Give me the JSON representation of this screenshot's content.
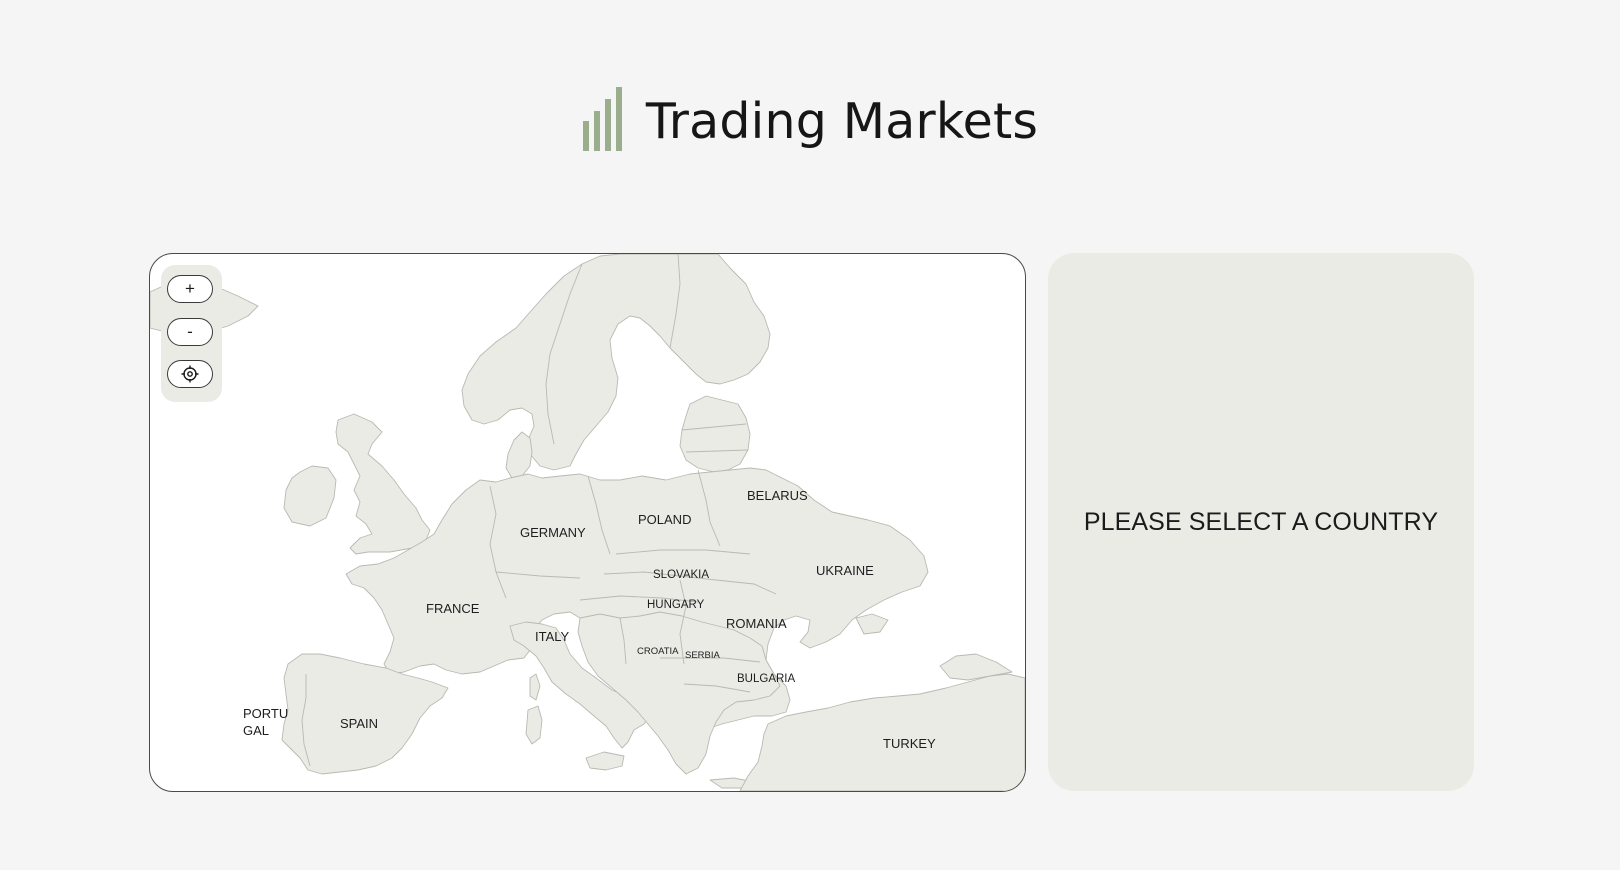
{
  "header": {
    "title": "Trading Markets",
    "logo_icon": "bar-chart-icon",
    "logo_color": "#9aae8d"
  },
  "map": {
    "controls": {
      "zoom_in_label": "+",
      "zoom_out_label": "-",
      "recenter_icon": "crosshair-icon"
    },
    "countries": {
      "germany": "GERMANY",
      "poland": "POLAND",
      "belarus": "BELARUS",
      "ukraine": "UKRAINE",
      "slovakia": "SLOVAKIA",
      "hungary": "HUNGARY",
      "romania": "ROMANIA",
      "france": "FRANCE",
      "italy": "ITALY",
      "croatia": "CROATIA",
      "serbia": "SERBIA",
      "bulgaria": "BULGARIA",
      "portugal_line1": "PORTU",
      "portugal_line2": "GAL",
      "spain": "SPAIN",
      "turkey": "TURKEY"
    },
    "land_color": "#ebebe6",
    "sea_color": "#ffffff"
  },
  "info_panel": {
    "message": "PLEASE SELECT A COUNTRY"
  }
}
